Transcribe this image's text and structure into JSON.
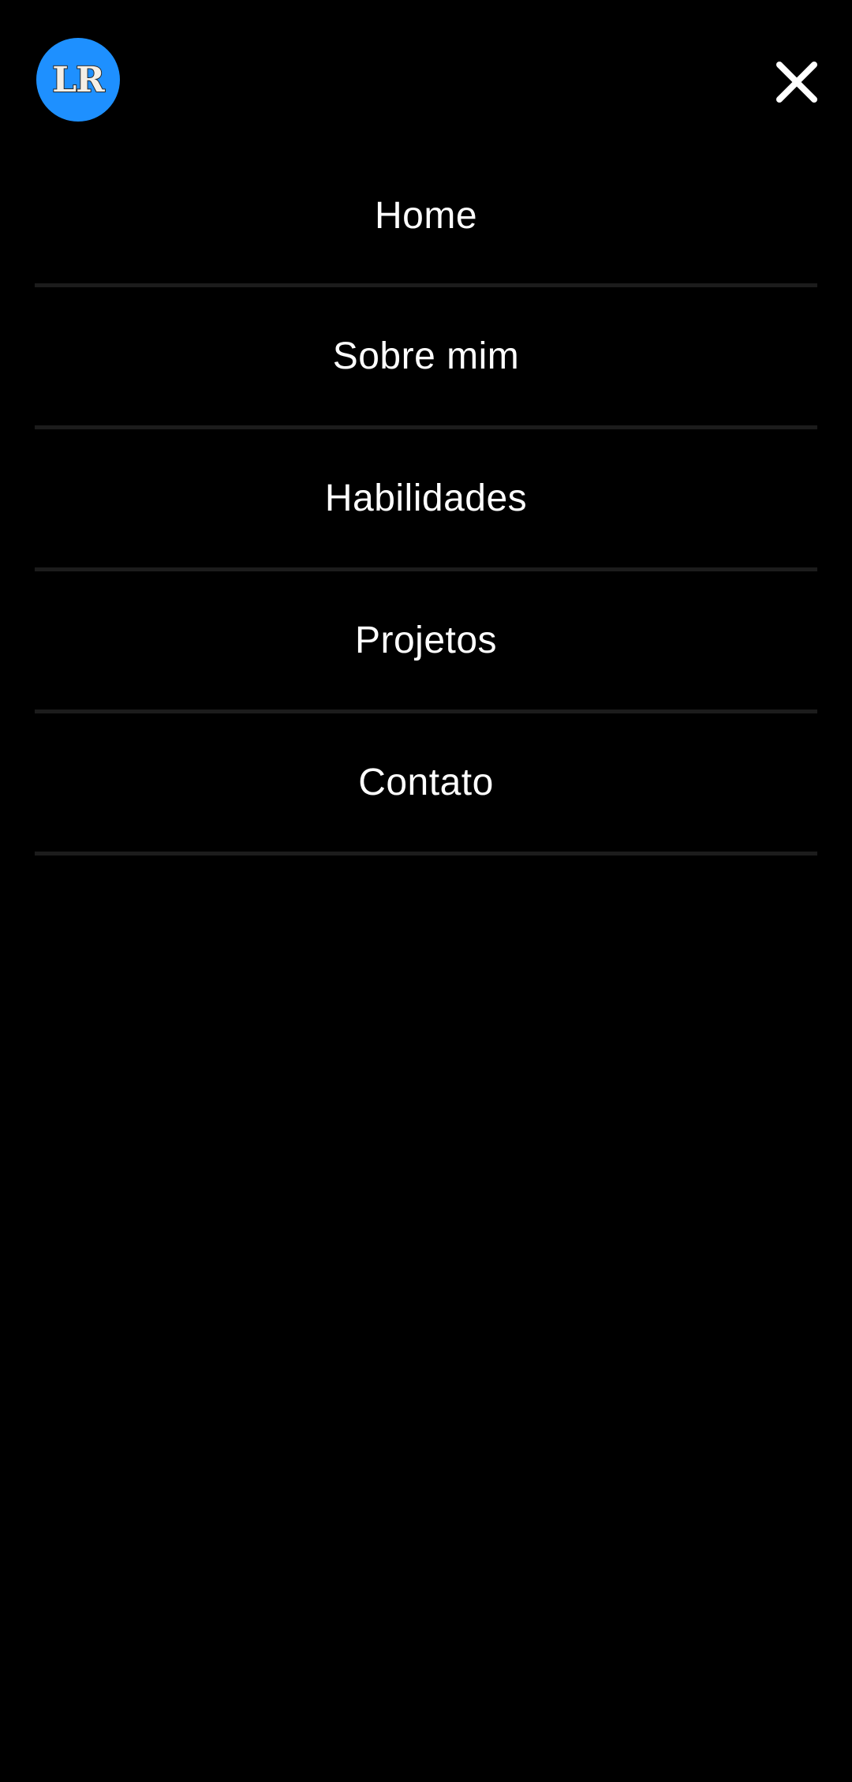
{
  "header": {
    "logo_text": "LR",
    "logo_color": "#1e90ff",
    "close_icon": "close-icon"
  },
  "nav": {
    "items": [
      {
        "label": "Home"
      },
      {
        "label": "Sobre mim"
      },
      {
        "label": "Habilidades"
      },
      {
        "label": "Projetos"
      },
      {
        "label": "Contato"
      }
    ]
  },
  "colors": {
    "background": "#000000",
    "text": "#ffffff",
    "divider": "#1c1c1c"
  }
}
